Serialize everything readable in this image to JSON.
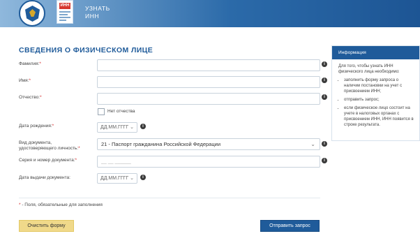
{
  "header": {
    "title_line1": "УЗНАТЬ",
    "title_line2": "ИНН",
    "doc_icon_text": "ИНН",
    "bg_color": "#2b6aa9"
  },
  "form": {
    "title": "СВЕДЕНИЯ О ФИЗИЧЕСКОМ ЛИЦЕ",
    "surname_label": "Фамилия:",
    "name_label": "Имя:",
    "patronymic_label": "Отчество:",
    "no_patronymic_label": "Нет отчества",
    "birthdate_label": "Дата рождения:",
    "birthdate_placeholder": "ДД.ММ.ГГГГ",
    "doctype_label_line1": "Вид документа,",
    "doctype_label_line2": "удостоверяющего личность:",
    "doctype_value": "21 - Паспорт гражданина Российской Федерации",
    "docnum_label": "Серия и номер документа:",
    "docnum_placeholder": "__ __ ______",
    "issue_date_label": "Дата выдачи документа:",
    "issue_date_placeholder": "ДД.ММ.ГГГГ",
    "required_mark": "*",
    "required_note": " - Поля, обязательные для заполнения",
    "info_glyph": "i"
  },
  "buttons": {
    "clear_label": "Очистить форму",
    "submit_label": "Отправить запрос"
  },
  "info_panel": {
    "title": "Информация",
    "intro": "Для того, чтобы узнать ИНН физического лица необходимо:",
    "items": [
      "заполнить форму запроса о наличии постановки на учет с присвоением ИНН;",
      "отправить запрос;",
      "если физическое лицо состоит на учете в налоговых органах с присвоением ИНН, ИНН появится в строке результата."
    ]
  },
  "colors": {
    "accent": "#1f5b9a",
    "required": "#d42a2a",
    "clear_button": "#f0d98a"
  }
}
